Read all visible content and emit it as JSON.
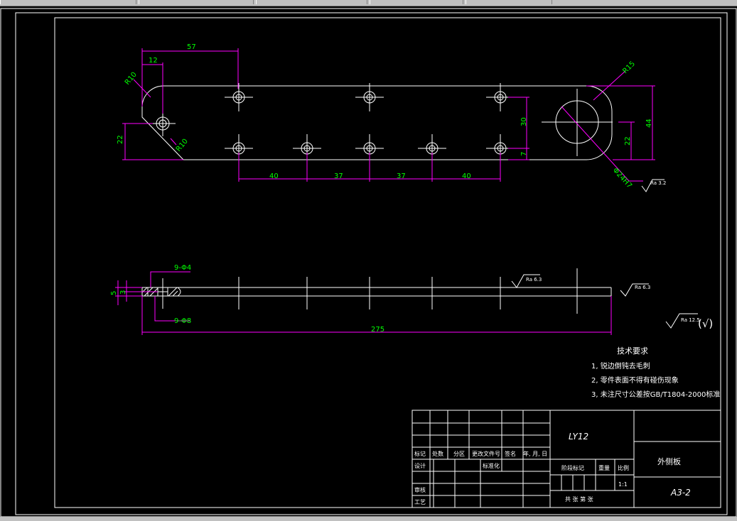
{
  "dimensions": {
    "d57": "57",
    "d12": "12",
    "r10a": "R10",
    "r10b": "R10",
    "d22_left": "22",
    "r15": "R15",
    "d30": "30",
    "d7": "7",
    "d44": "44",
    "d22_right": "22",
    "phi24": "Φ24H7",
    "d40a": "40",
    "d37a": "37",
    "d37b": "37",
    "d40b": "40",
    "d5": "5",
    "d3": "3",
    "holes_top": "9-Φ4",
    "holes_bottom": "9-Φ8",
    "d275": "275"
  },
  "roughness": {
    "r1": "Ra 3.2",
    "r2": "Ra 6.3",
    "r3": "Ra 6.3",
    "general": "Ra 12.5",
    "general_suffix": "(√)"
  },
  "tech": {
    "title": "技术要求",
    "items": [
      "1, 锐边倒钝去毛刺",
      "2, 零件表面不得有碰伤现象",
      "3, 未注尺寸公差按GB/T1804-2000标准"
    ]
  },
  "titleblock": {
    "material": "LY12",
    "part_name": "外侧板",
    "drawing_no": "A3-2",
    "scale": "1:1",
    "col_mark": "标记",
    "col_count": "处数",
    "col_zone": "分区",
    "col_docno": "更改文件号",
    "col_sign": "签名",
    "col_date": "年, 月, 日",
    "row_design": "设计",
    "row_std": "标准化",
    "row_check": "审核",
    "row_process": "工艺",
    "stage_mark": "阶段标记",
    "weight": "重量",
    "ratio": "比例",
    "sheets": "共  张  第  张"
  },
  "colors": {
    "background": "#000000",
    "outline": "#ffffff",
    "dimension": "#ff00ff",
    "dimtext": "#00ff00"
  }
}
